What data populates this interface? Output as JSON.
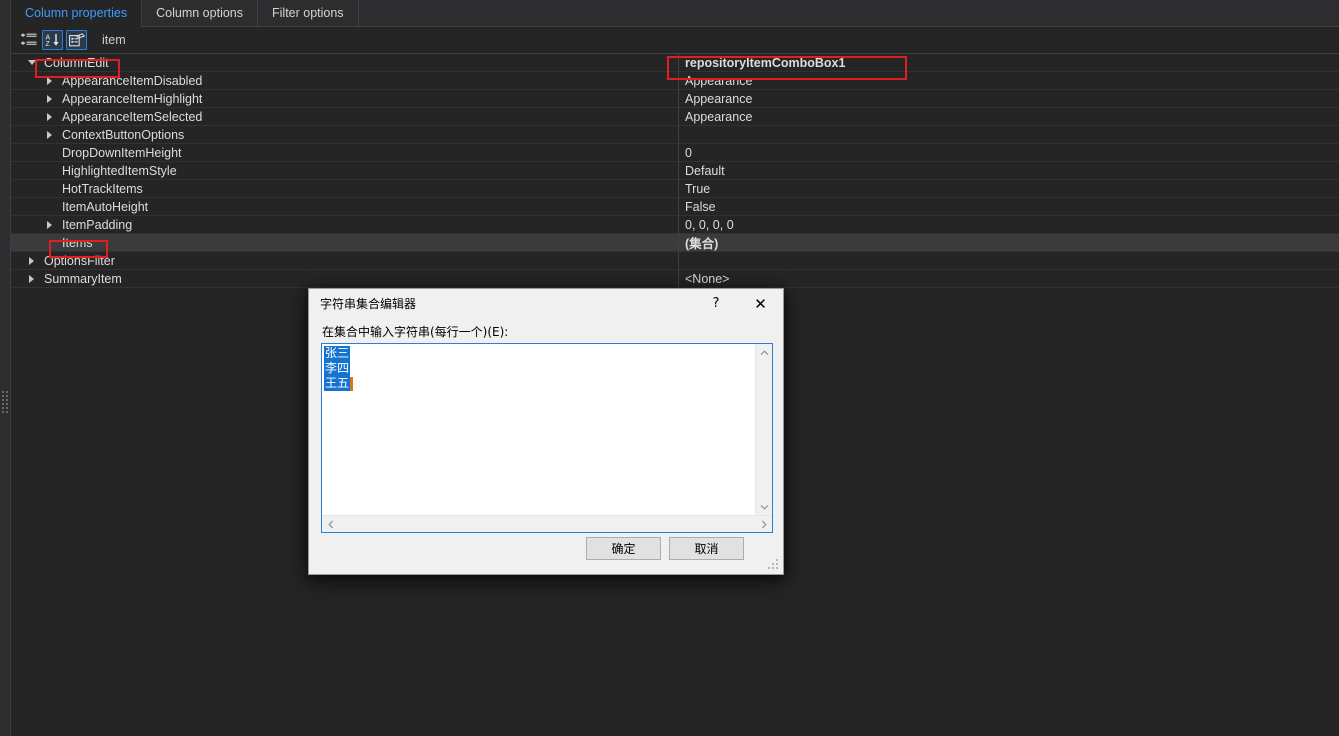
{
  "tabs": [
    {
      "label": "Column properties",
      "active": true
    },
    {
      "label": "Column options",
      "active": false
    },
    {
      "label": "Filter options",
      "active": false
    }
  ],
  "toolbar": {
    "categorized_icon": "categorized-icon",
    "alphabetical_icon": "alphabetical-sort-icon",
    "property_pages_icon": "property-pages-icon",
    "object_name": "item"
  },
  "property_grid": {
    "rows": [
      {
        "name": "ColumnEdit",
        "value": "repositoryItemComboBox1",
        "indent": 0,
        "expander": "open",
        "bold_value": true,
        "selected": false,
        "annotated_name": true,
        "annotated_value": true
      },
      {
        "name": "AppearanceItemDisabled",
        "value": "Appearance",
        "indent": 1,
        "expander": "closed",
        "bold_value": false,
        "selected": false,
        "annotated_name": false,
        "annotated_value": false
      },
      {
        "name": "AppearanceItemHighlight",
        "value": "Appearance",
        "indent": 1,
        "expander": "closed",
        "bold_value": false,
        "selected": false,
        "annotated_name": false,
        "annotated_value": false
      },
      {
        "name": "AppearanceItemSelected",
        "value": "Appearance",
        "indent": 1,
        "expander": "closed",
        "bold_value": false,
        "selected": false,
        "annotated_name": false,
        "annotated_value": false
      },
      {
        "name": "ContextButtonOptions",
        "value": "",
        "indent": 1,
        "expander": "closed",
        "bold_value": false,
        "selected": false,
        "annotated_name": false,
        "annotated_value": false
      },
      {
        "name": "DropDownItemHeight",
        "value": "0",
        "indent": 1,
        "expander": "none",
        "bold_value": false,
        "selected": false,
        "annotated_name": false,
        "annotated_value": false
      },
      {
        "name": "HighlightedItemStyle",
        "value": "Default",
        "indent": 1,
        "expander": "none",
        "bold_value": false,
        "selected": false,
        "annotated_name": false,
        "annotated_value": false
      },
      {
        "name": "HotTrackItems",
        "value": "True",
        "indent": 1,
        "expander": "none",
        "bold_value": false,
        "selected": false,
        "annotated_name": false,
        "annotated_value": false
      },
      {
        "name": "ItemAutoHeight",
        "value": "False",
        "indent": 1,
        "expander": "none",
        "bold_value": false,
        "selected": false,
        "annotated_name": false,
        "annotated_value": false
      },
      {
        "name": "ItemPadding",
        "value": "0, 0, 0, 0",
        "indent": 1,
        "expander": "closed",
        "bold_value": false,
        "selected": false,
        "annotated_name": false,
        "annotated_value": false
      },
      {
        "name": "Items",
        "value": "(集合)",
        "indent": 1,
        "expander": "none",
        "bold_value": true,
        "selected": true,
        "annotated_name": true,
        "annotated_value": false
      },
      {
        "name": "OptionsFilter",
        "value": "",
        "indent": 0,
        "expander": "closed",
        "bold_value": false,
        "selected": false,
        "annotated_name": false,
        "annotated_value": false
      },
      {
        "name": "SummaryItem",
        "value": "<None>",
        "indent": 0,
        "expander": "closed",
        "bold_value": false,
        "selected": false,
        "annotated_name": false,
        "annotated_value": false
      }
    ]
  },
  "dialog": {
    "title": "字符串集合编辑器",
    "help_glyph": "?",
    "close_glyph": "✕",
    "prompt": "在集合中输入字符串(每行一个)(E):",
    "editor_lines": [
      "张三",
      "李四",
      "王五"
    ],
    "ok_label": "确定",
    "cancel_label": "取消",
    "scroll_up_glyph": "▲",
    "scroll_down_glyph": "▼",
    "scroll_left_glyph": "◀",
    "scroll_right_glyph": "▶"
  },
  "colors": {
    "background": "#252526",
    "panel": "#2d2d30",
    "accent_tab": "#3b9dff",
    "annotation": "#e02020",
    "selection": "#1674d1",
    "dialog_bg": "#f0f0f0"
  }
}
